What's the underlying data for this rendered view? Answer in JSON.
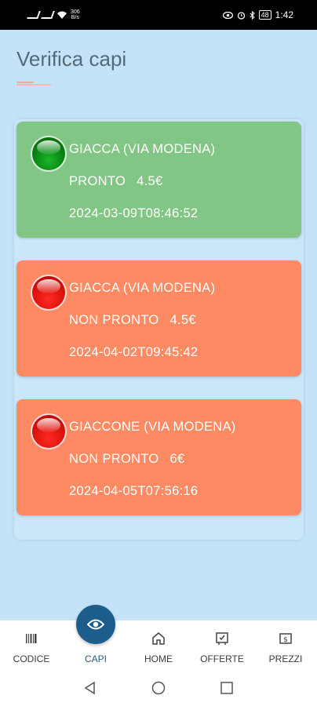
{
  "status_bar": {
    "network_speed_value": "306",
    "network_speed_unit": "B/s",
    "battery": "48",
    "time": "1:42"
  },
  "header": {
    "title": "Verifica capi"
  },
  "items": [
    {
      "name": "GIACCA (VIA MODENA)",
      "status": "PRONTO",
      "price": "4.5€",
      "timestamp": "2024-03-09T08:46:52",
      "state_color": "#82c685",
      "indicator": "green-light-icon"
    },
    {
      "name": "GIACCA (VIA MODENA)",
      "status": "NON PRONTO",
      "price": "4.5€",
      "timestamp": "2024-04-02T09:45:42",
      "state_color": "#fe8a63",
      "indicator": "red-light-icon"
    },
    {
      "name": "GIACCONE (VIA MODENA)",
      "status": "NON PRONTO",
      "price": "6€",
      "timestamp": "2024-04-05T07:56:16",
      "state_color": "#fe8a63",
      "indicator": "red-light-icon"
    }
  ],
  "bottom_nav": {
    "items": [
      {
        "label": "CODICE",
        "icon": "barcode-icon"
      },
      {
        "label": "CAPI",
        "icon": "eye-icon",
        "active": true
      },
      {
        "label": "HOME",
        "icon": "home-icon"
      },
      {
        "label": "OFFERTE",
        "icon": "offer-tag-icon"
      },
      {
        "label": "PREZZI",
        "icon": "price-icon"
      }
    ]
  },
  "colors": {
    "background": "#c4e3f8",
    "accent": "#1d5d8b",
    "ready": "#82c685",
    "not_ready": "#fe8a63"
  }
}
